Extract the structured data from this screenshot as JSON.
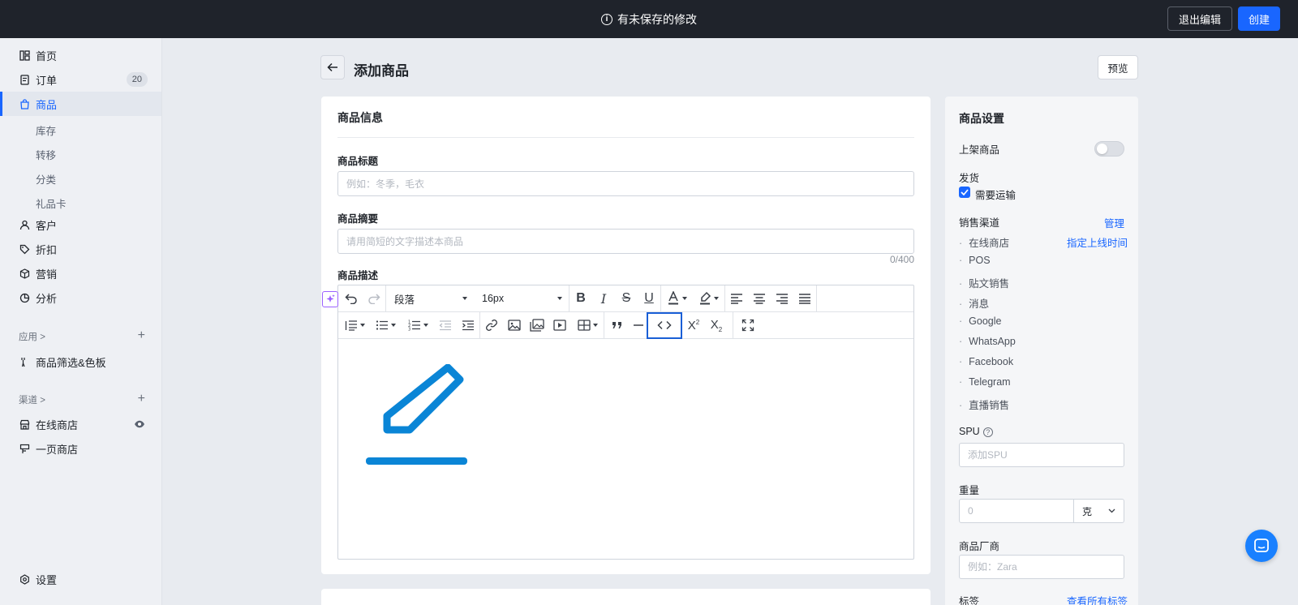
{
  "topbar": {
    "unsaved_text": "有未保存的修改",
    "exit_label": "退出编辑",
    "create_label": "创建"
  },
  "sidebar": {
    "items": [
      {
        "label": "首页",
        "icon": "dashboard-icon"
      },
      {
        "label": "订单",
        "icon": "order-icon",
        "badge": "20"
      },
      {
        "label": "商品",
        "icon": "bag-icon",
        "active": true
      },
      {
        "label": "客户",
        "icon": "person-icon"
      },
      {
        "label": "折扣",
        "icon": "tag-icon"
      },
      {
        "label": "营销",
        "icon": "cube-icon"
      },
      {
        "label": "分析",
        "icon": "chart-pie-icon"
      }
    ],
    "product_sub": [
      "库存",
      "转移",
      "分类",
      "礼品卡"
    ],
    "apps_title": "应用 >",
    "apps_items": [
      {
        "label": "商品筛选&色板",
        "icon": "filter-plugin-icon"
      }
    ],
    "channels_title": "渠道 >",
    "channels_items": [
      {
        "label": "在线商店",
        "icon": "store-icon"
      },
      {
        "label": "一页商店",
        "icon": "page-store-icon"
      }
    ],
    "settings_label": "设置"
  },
  "page": {
    "title": "添加商品",
    "preview_label": "预览"
  },
  "product_info": {
    "section_title": "商品信息",
    "title_label": "商品标题",
    "title_placeholder": "例如：冬季，毛衣",
    "summary_label": "商品摘要",
    "summary_placeholder": "请用简短的文字描述本商品",
    "summary_counter": "0/400",
    "desc_label": "商品描述"
  },
  "editor": {
    "paragraph": "段落",
    "font_size": "16px"
  },
  "settings": {
    "title": "商品设置",
    "publish_label": "上架商品",
    "shipping_label": "发货",
    "requires_shipping": "需要运输",
    "channels_label": "销售渠道",
    "manage_link": "管理",
    "schedule_link": "指定上线时间",
    "channels": [
      "在线商店",
      "POS",
      "贴文销售",
      "消息",
      "Google",
      "WhatsApp",
      "Facebook",
      "Telegram",
      "直播销售"
    ],
    "spu_label": "SPU",
    "spu_placeholder": "添加SPU",
    "weight_label": "重量",
    "weight_placeholder": "0",
    "weight_unit": "克",
    "vendor_label": "商品厂商",
    "vendor_placeholder": "例如：Zara",
    "tags_label": "标签",
    "view_tags_link": "查看所有标签"
  },
  "colors": {
    "accent": "#1966ff",
    "topbar_bg": "#1f232b",
    "pencil": "#0a85d6"
  }
}
